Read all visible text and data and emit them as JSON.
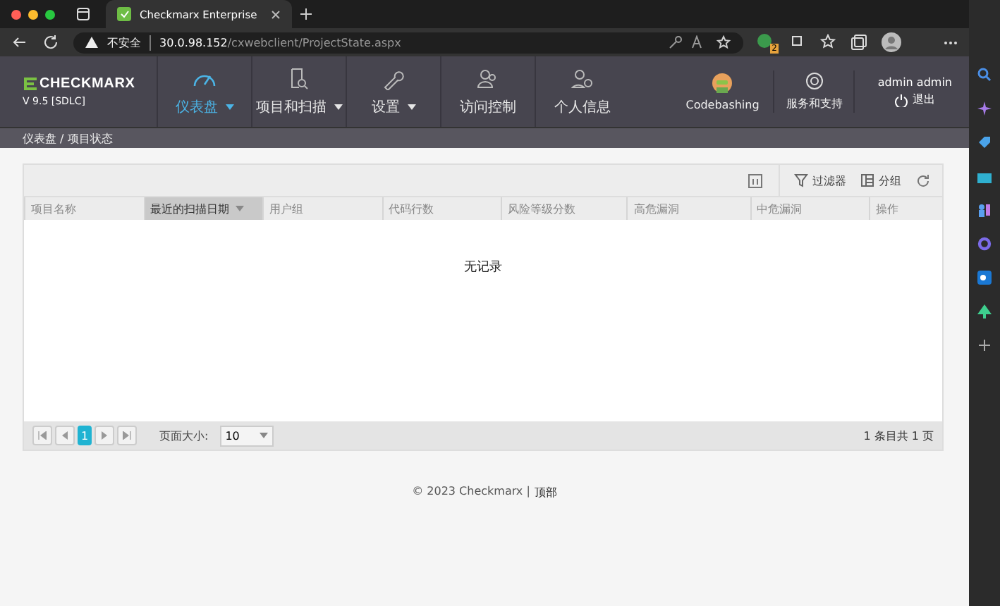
{
  "browser": {
    "tab_title": "Checkmarx Enterprise",
    "security_label": "不安全",
    "url_host": "30.0.98.152",
    "url_path": "/cxwebclient/ProjectState.aspx",
    "extension_badge": "2"
  },
  "header": {
    "logo": "CHECKMARX",
    "version": "V 9.5  [SDLC]",
    "nav": [
      {
        "label": "仪表盘",
        "selected": true,
        "has_menu": true
      },
      {
        "label": "项目和扫描",
        "selected": false,
        "has_menu": true
      },
      {
        "label": "设置",
        "selected": false,
        "has_menu": true
      },
      {
        "label": "访问控制",
        "selected": false,
        "has_menu": false
      },
      {
        "label": "个人信息",
        "selected": false,
        "has_menu": false
      }
    ],
    "codebashing": "Codebashing",
    "support": "服务和支持",
    "user": "admin admin",
    "logout": "退出"
  },
  "breadcrumb": "仪表盘 / 项目状态",
  "toolbar": {
    "filter": "过滤器",
    "group": "分组"
  },
  "columns": [
    {
      "label": "项目名称",
      "sorted": false
    },
    {
      "label": "最近的扫描日期",
      "sorted": true
    },
    {
      "label": "用户组",
      "sorted": false
    },
    {
      "label": "代码行数",
      "sorted": false
    },
    {
      "label": "风险等级分数",
      "sorted": false
    },
    {
      "label": "高危漏洞",
      "sorted": false
    },
    {
      "label": "中危漏洞",
      "sorted": false
    },
    {
      "label": "操作",
      "sorted": false
    }
  ],
  "empty_message": "无记录",
  "pager": {
    "pages": [
      {
        "label": "1",
        "selected": true
      }
    ],
    "page_size_label": "页面大小:",
    "page_size": "10",
    "summary": "1 条目共 1 页"
  },
  "footer": {
    "copyright": "© 2023 Checkmarx |",
    "top_link": "顶部"
  }
}
